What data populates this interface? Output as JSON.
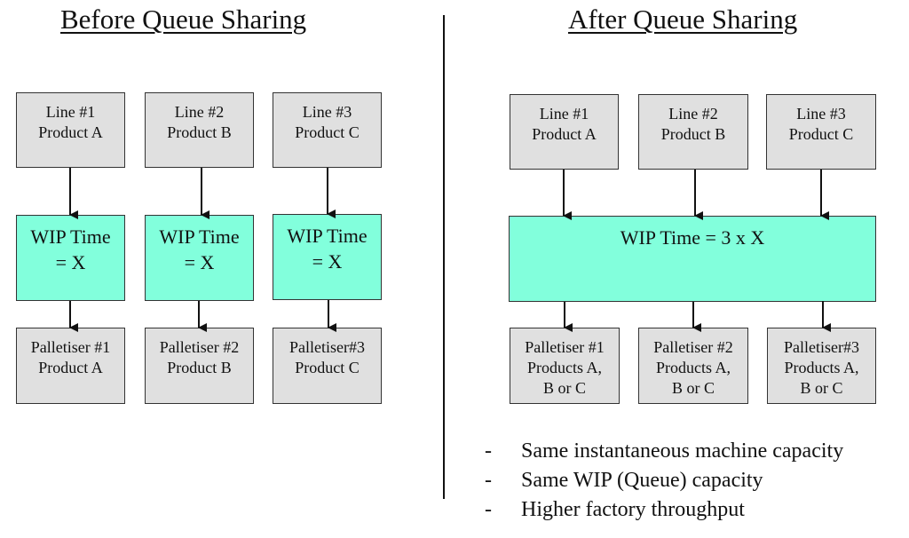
{
  "before": {
    "title": "Before Queue Sharing",
    "lines": [
      {
        "line": "Line #1",
        "product": "Product A"
      },
      {
        "line": "Line #2",
        "product": "Product B"
      },
      {
        "line": "Line #3",
        "product": "Product C"
      }
    ],
    "wip": [
      {
        "l1": "WIP Time",
        "l2": "= X"
      },
      {
        "l1": "WIP Time",
        "l2": "= X"
      },
      {
        "l1": "WIP Time",
        "l2": "= X"
      }
    ],
    "palletisers": [
      {
        "name": "Palletiser #1",
        "product": "Product A"
      },
      {
        "name": "Palletiser #2",
        "product": "Product B"
      },
      {
        "name": "Palletiser#3",
        "product": "Product C"
      }
    ]
  },
  "after": {
    "title": "After Queue Sharing",
    "lines": [
      {
        "line": "Line #1",
        "product": "Product A"
      },
      {
        "line": "Line #2",
        "product": "Product B"
      },
      {
        "line": "Line #3",
        "product": "Product C"
      }
    ],
    "wip": {
      "label": "WIP Time = 3 x X"
    },
    "palletisers": [
      {
        "name": "Palletiser #1",
        "p1": "Products A,",
        "p2": "B or C"
      },
      {
        "name": "Palletiser #2",
        "p1": "Products A,",
        "p2": "B or C"
      },
      {
        "name": "Palletiser#3",
        "p1": "Products A,",
        "p2": "B or C"
      }
    ],
    "bullets": [
      {
        "dash": "-",
        "text": "Same instantaneous machine capacity"
      },
      {
        "dash": "-",
        "text": "Same WIP (Queue) capacity"
      },
      {
        "dash": "-",
        "text": "Higher factory throughput"
      }
    ]
  },
  "colors": {
    "wip_fill": "#82ffdc",
    "box_fill": "#e0e0e0",
    "stroke": "#333333"
  }
}
